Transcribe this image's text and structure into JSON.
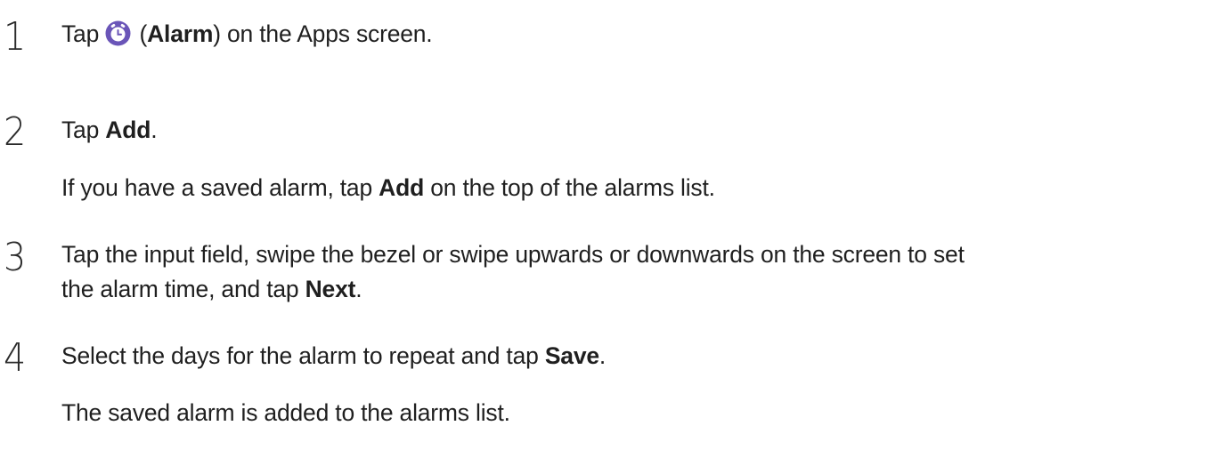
{
  "icon_color": "#6a55b8",
  "steps": [
    {
      "num": "1",
      "pre": "Tap",
      "icon": "alarm-clock-icon",
      "paren_open": " (",
      "bold": "Alarm",
      "post": ") on the Apps screen."
    },
    {
      "num": "2",
      "pre": "Tap ",
      "bold": "Add",
      "post": ".",
      "sub_pre": "If you have a saved alarm, tap ",
      "sub_bold": "Add",
      "sub_post": " on the top of the alarms list."
    },
    {
      "num": "3",
      "line1": "Tap the input field, swipe the bezel or swipe upwards or downwards on the screen to set",
      "line2_pre": "the alarm time, and tap ",
      "line2_bold": "Next",
      "line2_post": "."
    },
    {
      "num": "4",
      "pre": "Select the days for the alarm to repeat and tap ",
      "bold": "Save",
      "post": ".",
      "sub": "The saved alarm is added to the alarms list."
    }
  ]
}
